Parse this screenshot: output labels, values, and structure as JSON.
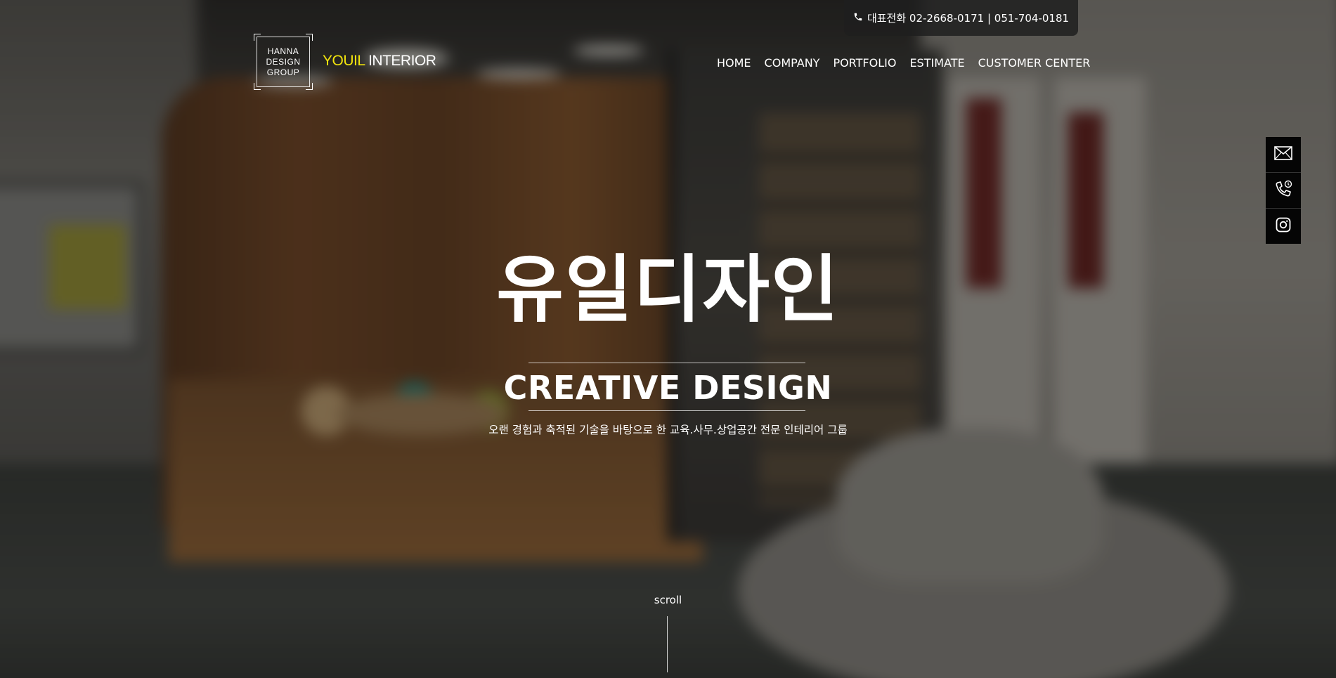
{
  "header": {
    "phone_label": "대표전화 02-2668-0171 | 051-704-0181"
  },
  "logo": {
    "box_lines": [
      "HANNA",
      "DESIGN",
      "GROUP"
    ],
    "name_accent": "YOUIL",
    "name_rest": " INTERIOR"
  },
  "nav": {
    "items": [
      "HOME",
      "COMPANY",
      "PORTFOLIO",
      "ESTIMATE",
      "CUSTOMER CENTER"
    ]
  },
  "quick_menu": {
    "icons": [
      "mail-icon",
      "phone-call-icon",
      "instagram-icon"
    ]
  },
  "hero": {
    "title": "유일디자인",
    "subtitle": "CREATIVE DESIGN",
    "description": "오랜 경험과 축적된 기술을 바탕으로 한 교육.사무.상업공간 전문 인테리어 그룹",
    "scroll": "scroll"
  },
  "colors": {
    "accent": "#f2e40d",
    "text": "#ffffff",
    "quick_bg": "#050505"
  }
}
